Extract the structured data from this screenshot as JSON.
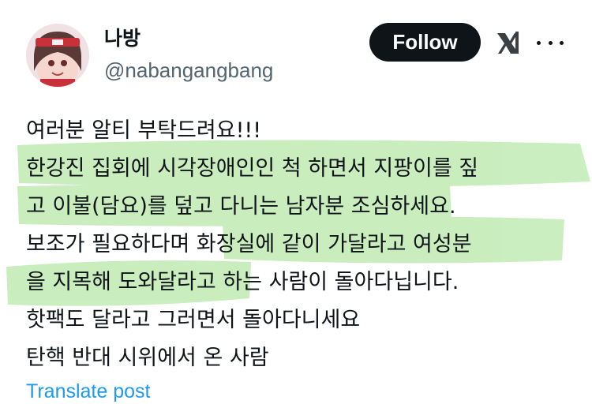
{
  "user": {
    "display_name": "나방",
    "handle": "@nabangangbang"
  },
  "actions": {
    "follow_label": "Follow",
    "grok_icon": "grok-icon",
    "more_icon": "more-options-icon"
  },
  "tweet": {
    "lines": [
      "여러분 알티 부탁드려요!!!",
      "한강진 집회에 시각장애인인 척 하면서 지팡이를 짚",
      "고 이불(담요)를 덮고 다니는 남자분 조심하세요.",
      "보조가 필요하다며 화장실에 같이 가달라고 여성분",
      "을 지목해 도와달라고 하는 사람이 돌아다닙니다.",
      "핫팩도 달라고 그러면서 돌아다니세요",
      "탄핵 반대 시위에서 온 사람"
    ]
  },
  "translate_label": "Translate post",
  "colors": {
    "follow_bg": "#0f1419",
    "handle": "#536471",
    "link": "#1d9bf0",
    "highlight": "#9fe08a"
  }
}
